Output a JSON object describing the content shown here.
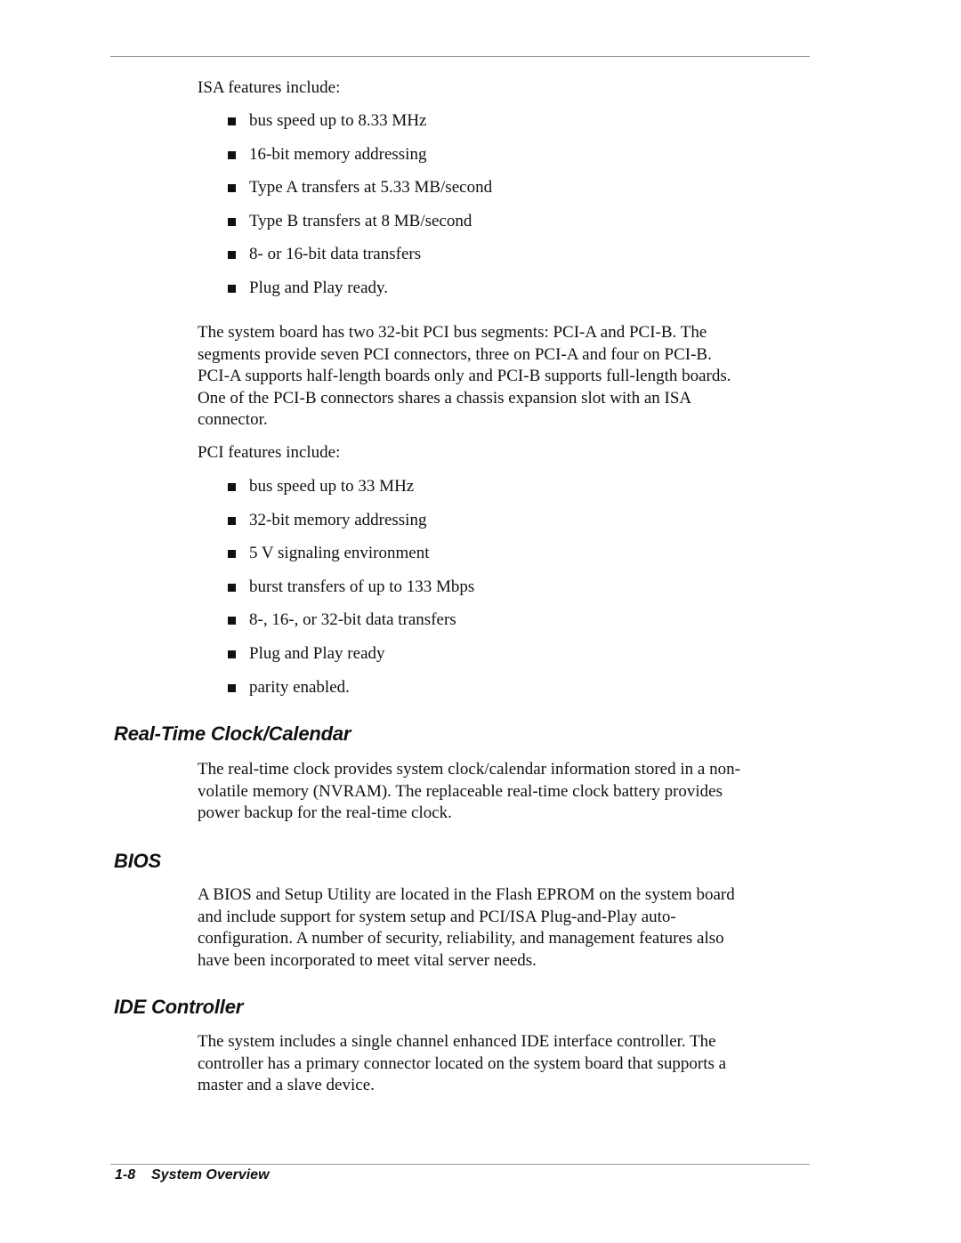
{
  "isa": {
    "intro": "ISA features include:",
    "features": [
      "bus speed up to 8.33 MHz",
      "16-bit memory addressing",
      "Type A transfers at 5.33 MB/second",
      "Type B transfers at 8 MB/second",
      "8- or 16-bit data transfers",
      "Plug and Play ready."
    ]
  },
  "pci": {
    "paragraph_lines": [
      "The system board has two 32-bit PCI bus segments: PCI-A and PCI-B. The",
      "segments provide seven PCI connectors, three on PCI-A and four on PCI-B.",
      "PCI-A supports half-length boards only and PCI-B supports full-length boards.",
      "One of the PCI-B connectors shares a chassis expansion slot with an ISA",
      "connector."
    ],
    "intro": "PCI features include:",
    "features": [
      "bus speed up to 33 MHz",
      "32-bit memory addressing",
      "5 V signaling environment",
      "burst transfers of up to 133 Mbps",
      "8-, 16-, or 32-bit data transfers",
      "Plug and Play ready",
      "parity enabled."
    ]
  },
  "sections": [
    {
      "heading": "Real-Time Clock/Calendar",
      "lines": [
        "The real-time clock provides system clock/calendar information stored in a non-",
        "volatile memory (NVRAM). The replaceable real-time clock battery provides",
        "power backup for the real-time clock."
      ]
    },
    {
      "heading": "BIOS",
      "lines": [
        "A BIOS and Setup Utility are located in the Flash EPROM on the system board",
        "and include support for system setup and PCI/ISA Plug-and-Play auto-",
        "configuration. A number of security, reliability, and management features also",
        "have been incorporated to meet vital server needs."
      ]
    },
    {
      "heading": "IDE Controller",
      "lines": [
        "The system includes a single channel enhanced IDE interface controller. The",
        "controller has a primary connector located on the system board that supports a",
        "master and a slave device."
      ]
    }
  ],
  "footer": {
    "page_number": "1-8",
    "chapter_title": "System Overview"
  }
}
